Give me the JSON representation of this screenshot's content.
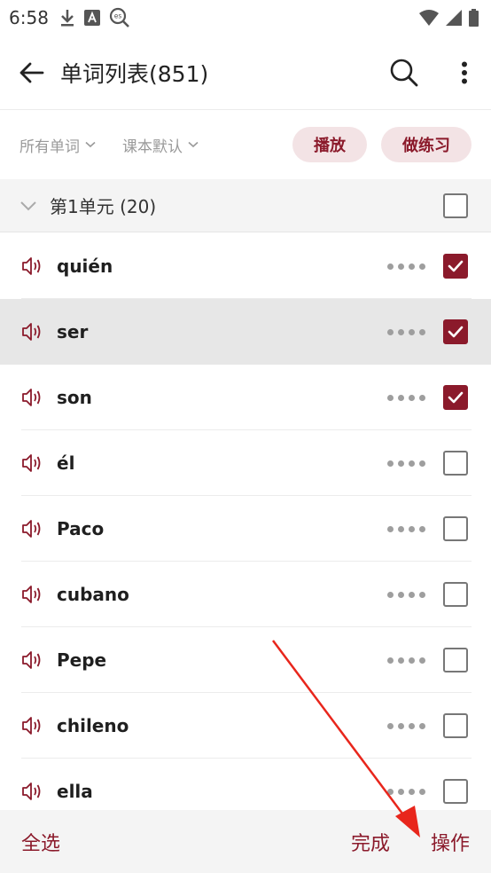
{
  "status_bar": {
    "time": "6:58",
    "icons": [
      "download-icon",
      "font-a-icon",
      "search-es-icon",
      "wifi-icon",
      "signal-icon",
      "battery-icon"
    ],
    "es_label": "es"
  },
  "app_bar": {
    "title": "单词列表(851)",
    "icons": [
      "back-arrow-icon",
      "search-icon",
      "more-vertical-icon"
    ]
  },
  "filters": {
    "all_words": "所有单词",
    "textbook_default": "课本默认",
    "play_label": "播放",
    "practice_label": "做练习"
  },
  "unit": {
    "title": "第1单元 (20)",
    "checked": false
  },
  "words": [
    {
      "text": "quién",
      "checked": true,
      "highlight": false
    },
    {
      "text": "ser",
      "checked": true,
      "highlight": true
    },
    {
      "text": "son",
      "checked": true,
      "highlight": false
    },
    {
      "text": "él",
      "checked": false,
      "highlight": false
    },
    {
      "text": "Paco",
      "checked": false,
      "highlight": false
    },
    {
      "text": "cubano",
      "checked": false,
      "highlight": false
    },
    {
      "text": "Pepe",
      "checked": false,
      "highlight": false
    },
    {
      "text": "chileno",
      "checked": false,
      "highlight": false
    },
    {
      "text": "ella",
      "checked": false,
      "highlight": false
    }
  ],
  "bottom_bar": {
    "select_all": "全选",
    "done": "完成",
    "operate": "操作"
  },
  "colors": {
    "accent": "#8b1a2b",
    "pill_bg": "#f3e3e5",
    "annotation_arrow": "#e8261c"
  }
}
